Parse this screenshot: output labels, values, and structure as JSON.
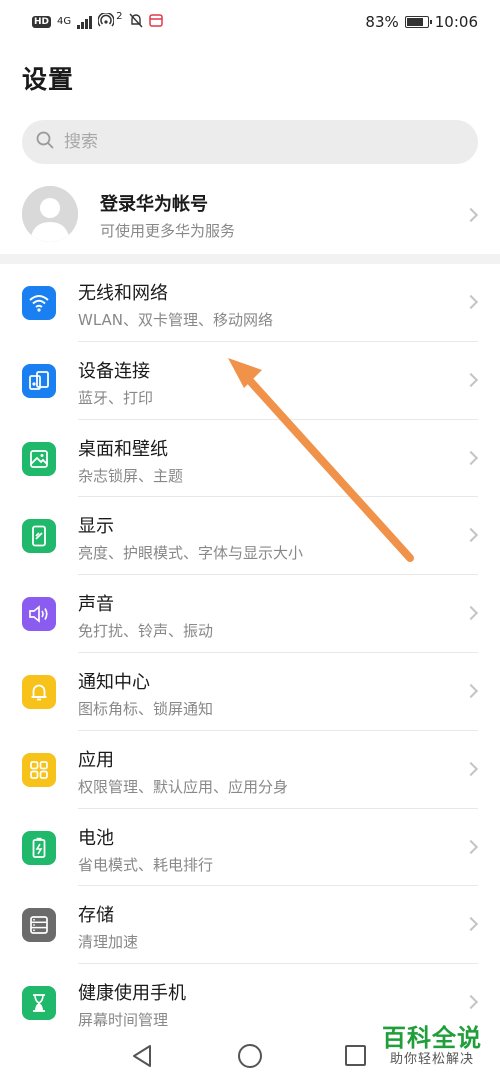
{
  "status_bar": {
    "hd_label": "HD",
    "network_label": "4G",
    "hotspot_count": "2",
    "battery_percent": "83%",
    "battery_level": 0.83,
    "time": "10:06"
  },
  "page_title": "设置",
  "search": {
    "placeholder": "搜索"
  },
  "account": {
    "title": "登录华为帐号",
    "subtitle": "可使用更多华为服务"
  },
  "menu": {
    "items": [
      {
        "title": "无线和网络",
        "subtitle": "WLAN、双卡管理、移动网络",
        "icon": "wifi-icon",
        "color": "#1a7ff0"
      },
      {
        "title": "设备连接",
        "subtitle": "蓝牙、打印",
        "icon": "device-connect-icon",
        "color": "#1a7ff0"
      },
      {
        "title": "桌面和壁纸",
        "subtitle": "杂志锁屏、主题",
        "icon": "wallpaper-icon",
        "color": "#20b86a"
      },
      {
        "title": "显示",
        "subtitle": "亮度、护眼模式、字体与显示大小",
        "icon": "display-icon",
        "color": "#20b86a"
      },
      {
        "title": "声音",
        "subtitle": "免打扰、铃声、振动",
        "icon": "sound-icon",
        "color": "#8a5cf0"
      },
      {
        "title": "通知中心",
        "subtitle": "图标角标、锁屏通知",
        "icon": "bell-icon",
        "color": "#f7c21a"
      },
      {
        "title": "应用",
        "subtitle": "权限管理、默认应用、应用分身",
        "icon": "apps-icon",
        "color": "#f7c21a"
      },
      {
        "title": "电池",
        "subtitle": "省电模式、耗电排行",
        "icon": "battery-icon",
        "color": "#20b86a"
      },
      {
        "title": "存储",
        "subtitle": "清理加速",
        "icon": "storage-icon",
        "color": "#6b6b6b"
      },
      {
        "title": "健康使用手机",
        "subtitle": "屏幕时间管理",
        "icon": "hourglass-icon",
        "color": "#20b86a"
      }
    ]
  },
  "annotation_arrow_color": "#f0924a",
  "watermark": {
    "title": "百科全说",
    "subtitle": "助你轻松解决"
  }
}
